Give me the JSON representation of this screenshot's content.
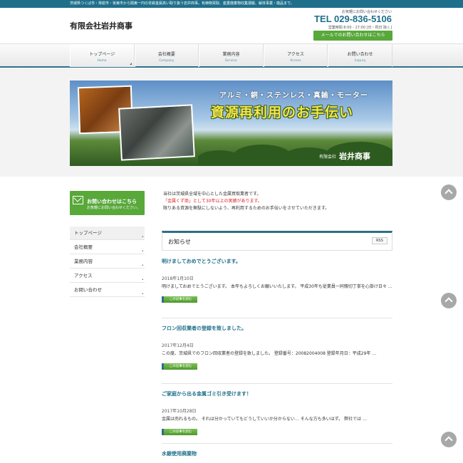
{
  "header": {
    "tagline": "茨城県つくば市・常総市・坂東市から関東一円の非鉄金属高い取り扱う岩井商事。有価物買取、産業廃棄物収集運搬、解体事業・廃品まで。",
    "logo": "有限会社岩井商事",
    "contact_caption": "お気軽にお問い合わせください",
    "tel": "TEL 029-836-5106",
    "hours": "営業時間 8:00 - 17:00 [日・祝日 除く]",
    "mail_button": "メールでのお問い合わせはこちら"
  },
  "nav": [
    {
      "jp": "トップページ",
      "en": "Home"
    },
    {
      "jp": "会社概要",
      "en": "Company"
    },
    {
      "jp": "業務内容",
      "en": "Service"
    },
    {
      "jp": "アクセス",
      "en": "Access"
    },
    {
      "jp": "お問い合わせ",
      "en": "Inquiry"
    }
  ],
  "hero": {
    "subtitle": "アルミ・銅・ステンレス・真鍮・モーター",
    "title": "資源再利用のお手伝い",
    "company_small": "有限会社",
    "company_big": "岩井商事"
  },
  "sidebar": {
    "contact_title": "お問い合わせはこちら",
    "contact_sub": "お気軽にお問い合わせください。",
    "menu": [
      "トップページ",
      "会社概要",
      "業務内容",
      "アクセス",
      "お問い合わせ"
    ]
  },
  "intro": {
    "line1": "当社は茨城県全域を中心とした金属買取業者です。",
    "line2_red": "「金属くず商」として30年以上の実績があります。",
    "line3": "限りある資源を無駄にしないよう、再利用するためのお手伝いをさせていただきます。"
  },
  "news": {
    "heading": "お知らせ",
    "rss": "RSS",
    "read_more": "この記事を読む",
    "posts": [
      {
        "title": "明けましておめでとうございます。",
        "date": "2018年1月10日",
        "body": "明けましておめでとうございます。 本年もよろしくお願いいたします。 平成30年も従業員一同親切丁寧を心掛け日々 …"
      },
      {
        "title": "フロン回収業者の登録を致しました。",
        "date": "2017年12月4日",
        "body": "この度、茨城県でのフロン回収業者の登録を致しました。 登録番号：20082004008 登録年月日：平成29年 …"
      },
      {
        "title": "ご家庭から出る金属ゴミ引き受けます！",
        "date": "2017年10月28日",
        "body": "金属は売れるもの。 それは分かっていてもどうしていいか分からない… そんな方も多いはず。 弊社では …"
      },
      {
        "title": "水銀使用廃棄物"
      }
    ]
  }
}
